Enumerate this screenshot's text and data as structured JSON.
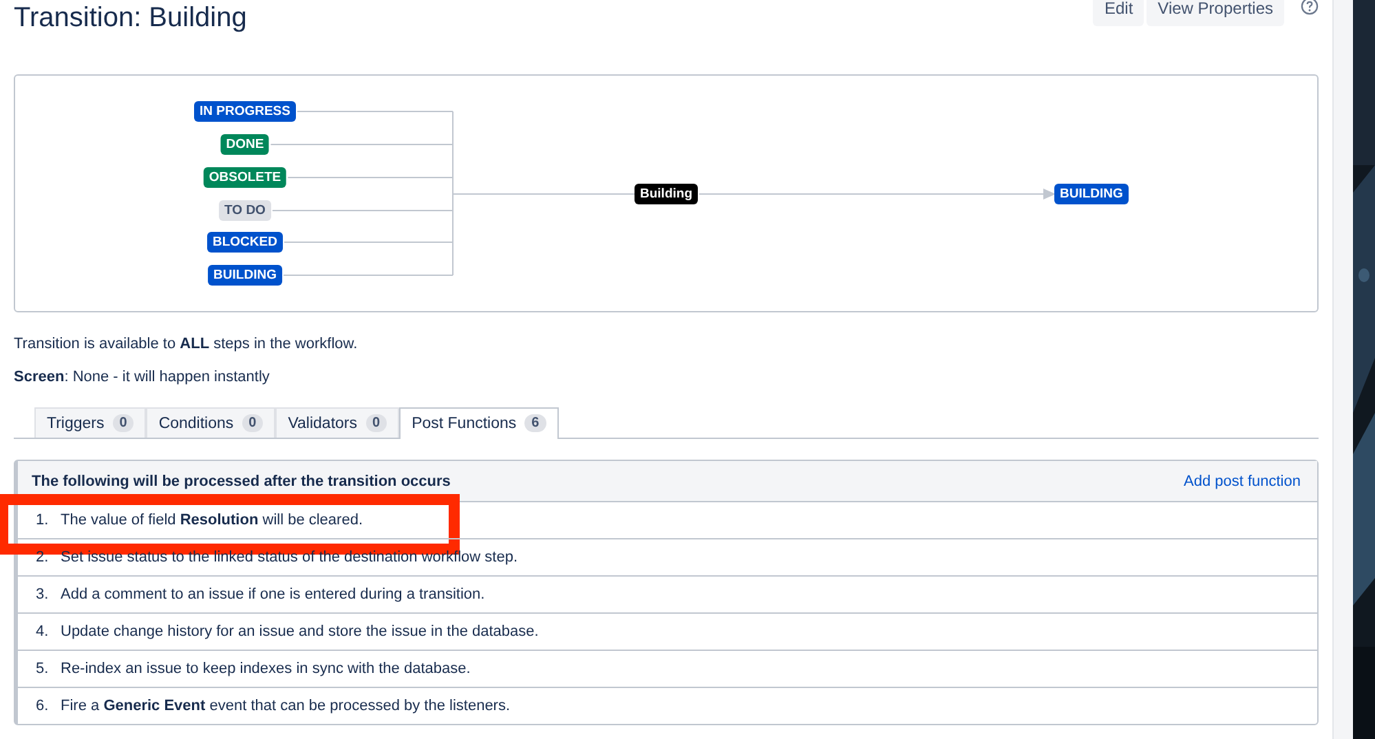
{
  "page": {
    "title": "Transition: Building",
    "actions": [
      "Edit",
      "View Properties"
    ]
  },
  "diagram": {
    "sources": [
      {
        "label": "IN PROGRESS",
        "kind": "indeterminate"
      },
      {
        "label": "DONE",
        "kind": "done"
      },
      {
        "label": "OBSOLETE",
        "kind": "done"
      },
      {
        "label": "TO DO",
        "kind": "new"
      },
      {
        "label": "BLOCKED",
        "kind": "indeterminate"
      },
      {
        "label": "BUILDING",
        "kind": "indeterminate"
      }
    ],
    "transition": "Building",
    "target": {
      "label": "BUILDING",
      "kind": "indeterminate"
    }
  },
  "info": [
    "Transition is available to **ALL** steps in the workflow.",
    "**Screen**: None - it will happen instantly"
  ],
  "tabs": [
    {
      "label": "Triggers",
      "count": "0",
      "selected": false
    },
    {
      "label": "Conditions",
      "count": "0",
      "selected": false
    },
    {
      "label": "Validators",
      "count": "0",
      "selected": false
    },
    {
      "label": "Post Functions",
      "count": "6",
      "selected": true
    }
  ],
  "post_functions": {
    "heading": "The following will be processed after the transition occurs",
    "add_link": "Add post function",
    "rows": [
      {
        "number": "1.",
        "text": "The value of field **Resolution** will be cleared.",
        "highlighted": true
      },
      {
        "number": "2.",
        "text": "Set issue status to the linked status of the destination workflow step.",
        "highlighted": false
      },
      {
        "number": "3.",
        "text": "Add a comment to an issue if one is entered during a transition.",
        "highlighted": false
      },
      {
        "number": "4.",
        "text": "Update change history for an issue and store the issue in the database.",
        "highlighted": false
      },
      {
        "number": "5.",
        "text": "Re-index an issue to keep indexes in sync with the database.",
        "highlighted": false
      },
      {
        "number": "6.",
        "text": "Fire a **Generic Event** event that can be processed by the listeners.",
        "highlighted": false
      }
    ]
  }
}
